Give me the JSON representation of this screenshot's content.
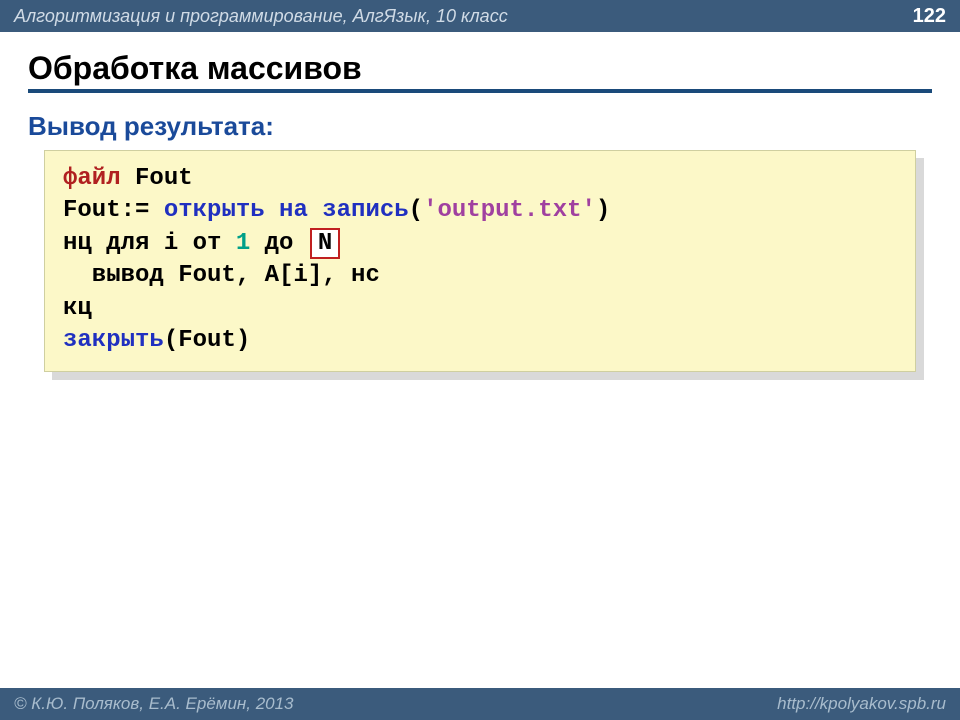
{
  "header": {
    "breadcrumb": "Алгоритмизация и программирование, АлгЯзык, 10 класс",
    "page_number": "122"
  },
  "title": "Обработка массивов",
  "subtitle": "Вывод результата:",
  "code": {
    "l1_kw": "файл",
    "l1_rest": " Fout",
    "l2_a": "Fout:= ",
    "l2_open": "открыть на запись",
    "l2_paren_open": "(",
    "l2_str": "'output.txt'",
    "l2_paren_close": ")",
    "l3_a": "нц для i от ",
    "l3_one": "1",
    "l3_b": " до ",
    "l3_box": "N",
    "l4": "  вывод Fout, A[i], нс",
    "l5": "кц",
    "l6_close": "закрыть",
    "l6_rest": "(Fout)"
  },
  "footer": {
    "left": "© К.Ю. Поляков, Е.А. Ерёмин, 2013",
    "right": "http://kpolyakov.spb.ru"
  }
}
